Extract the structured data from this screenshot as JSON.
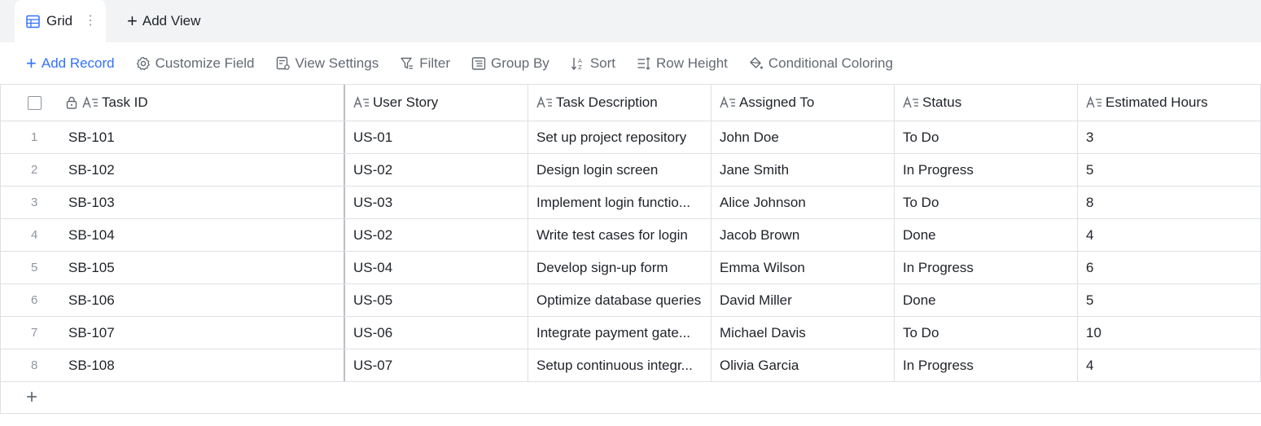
{
  "tabs": {
    "active_label": "Grid",
    "add_view_label": "Add View"
  },
  "toolbar": {
    "add_record": "Add Record",
    "customize_field": "Customize Field",
    "view_settings": "View Settings",
    "filter": "Filter",
    "group_by": "Group By",
    "sort": "Sort",
    "row_height": "Row Height",
    "conditional_coloring": "Conditional Coloring"
  },
  "columns": [
    "Task ID",
    "User Story",
    "Task Description",
    "Assigned To",
    "Status",
    "Estimated Hours"
  ],
  "rows": [
    {
      "num": "1",
      "task_id": "SB-101",
      "user_story": "US-01",
      "description": "Set up project repository",
      "assigned": "John Doe",
      "status": "To Do",
      "hours": "3"
    },
    {
      "num": "2",
      "task_id": "SB-102",
      "user_story": "US-02",
      "description": "Design login screen",
      "assigned": "Jane Smith",
      "status": "In Progress",
      "hours": "5"
    },
    {
      "num": "3",
      "task_id": "SB-103",
      "user_story": "US-03",
      "description": "Implement login functio...",
      "assigned": "Alice Johnson",
      "status": "To Do",
      "hours": "8"
    },
    {
      "num": "4",
      "task_id": "SB-104",
      "user_story": "US-02",
      "description": "Write test cases for login",
      "assigned": "Jacob Brown",
      "status": "Done",
      "hours": "4"
    },
    {
      "num": "5",
      "task_id": "SB-105",
      "user_story": "US-04",
      "description": "Develop sign-up form",
      "assigned": "Emma Wilson",
      "status": "In Progress",
      "hours": "6"
    },
    {
      "num": "6",
      "task_id": "SB-106",
      "user_story": "US-05",
      "description": "Optimize database queries",
      "assigned": "David Miller",
      "status": "Done",
      "hours": "5"
    },
    {
      "num": "7",
      "task_id": "SB-107",
      "user_story": "US-06",
      "description": "Integrate payment gate...",
      "assigned": "Michael Davis",
      "status": "To Do",
      "hours": "10"
    },
    {
      "num": "8",
      "task_id": "SB-108",
      "user_story": "US-07",
      "description": "Setup continuous integr...",
      "assigned": "Olivia Garcia",
      "status": "In Progress",
      "hours": "4"
    }
  ],
  "colors": {
    "accent": "#3370ff",
    "muted": "#646a73",
    "border": "#dee0e3",
    "tabbar_bg": "#f2f3f5"
  },
  "icons": {
    "grid_tab": "grid-icon",
    "more": "more-vertical-icon",
    "field_type": "text-field-icon",
    "lock": "lock-icon"
  }
}
